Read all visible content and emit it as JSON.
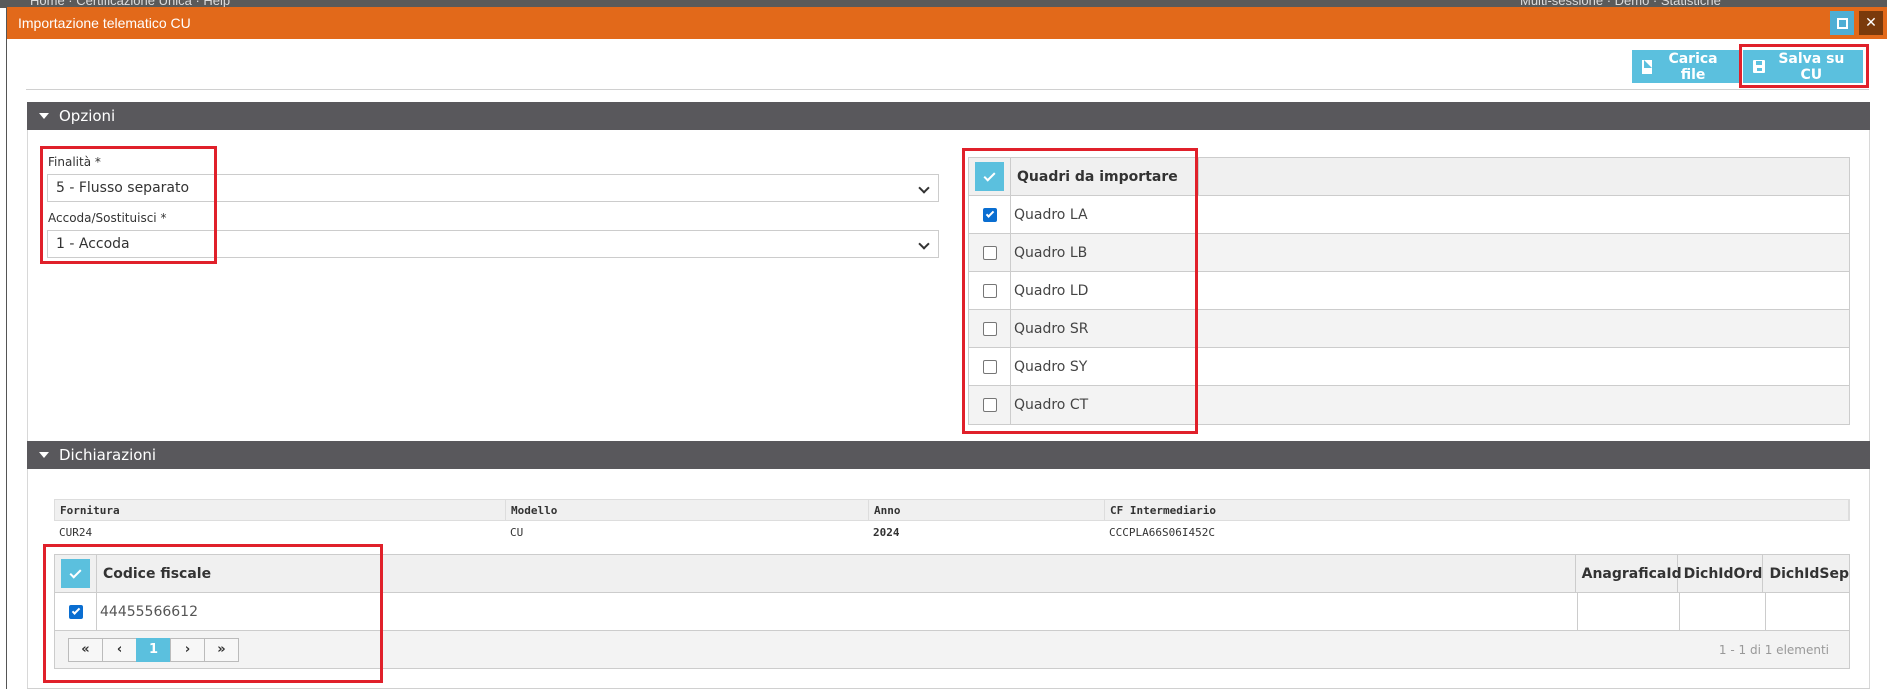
{
  "window": {
    "title": "Importazione telematico CU",
    "maximize_icon": "maximize-icon",
    "close_icon": "close-icon",
    "accent_color": "#e2691a"
  },
  "toolbar": {
    "carica_label": "Carica file",
    "salva_label": "Salva su CU"
  },
  "opzioni": {
    "title": "Opzioni",
    "finalita": {
      "label": "Finalità *",
      "value": "5 - Flusso separato"
    },
    "accoda": {
      "label": "Accoda/Sostituisci *",
      "value": "1 - Accoda"
    },
    "quadri": {
      "header": "Quadri da importare",
      "items": [
        {
          "label": "Quadro LA",
          "checked": true
        },
        {
          "label": "Quadro LB",
          "checked": false
        },
        {
          "label": "Quadro LD",
          "checked": false
        },
        {
          "label": "Quadro SR",
          "checked": false
        },
        {
          "label": "Quadro SY",
          "checked": false
        },
        {
          "label": "Quadro CT",
          "checked": false
        }
      ]
    }
  },
  "dichiarazioni": {
    "title": "Dichiarazioni",
    "info_headers": [
      "Fornitura",
      "Modello",
      "Anno",
      "CF Intermediario"
    ],
    "info_row": [
      "CUR24",
      "CU",
      "2024",
      "CCCPLA66S06I452C"
    ],
    "grid_headers": {
      "codice_fiscale": "Codice fiscale",
      "anagrafica": "AnagraficaId",
      "dich_ord": "DichIdOrd",
      "dich_sep": "DichIdSep"
    },
    "rows": [
      {
        "codice_fiscale": "44455566612",
        "checked": true
      }
    ],
    "pager": {
      "first": "«",
      "prev": "‹",
      "page": "1",
      "next": "›",
      "last": "»",
      "info": "1 - 1 di 1 elementi"
    }
  }
}
